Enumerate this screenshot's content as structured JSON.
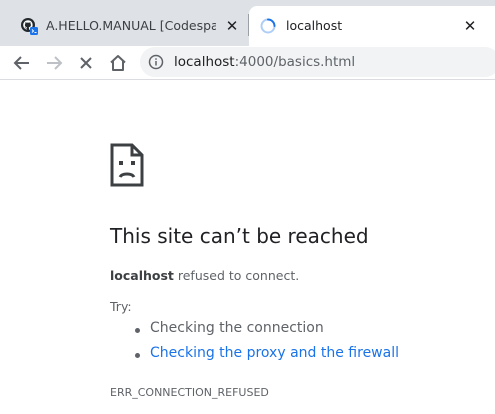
{
  "tabs": [
    {
      "title": "A.HELLO.MANUAL [Codespaces]",
      "favicon": "github-codespaces-icon",
      "active": false
    },
    {
      "title": "localhost",
      "favicon": "loading-spinner-icon",
      "active": true
    }
  ],
  "address_bar": {
    "host": "localhost",
    "path": ":4000/basics.html"
  },
  "error_page": {
    "heading": "This site can’t be reached",
    "host": "localhost",
    "description_suffix": " refused to connect.",
    "try_label": "Try:",
    "suggestions": [
      {
        "text": "Checking the connection",
        "is_link": false
      },
      {
        "text": "Checking the proxy and the firewall",
        "is_link": true
      }
    ],
    "error_code": "ERR_CONNECTION_REFUSED"
  },
  "colors": {
    "tabbar_bg": "#dee1e6",
    "link": "#1a73e8",
    "text_secondary": "#5f6368",
    "heading": "#202124"
  }
}
